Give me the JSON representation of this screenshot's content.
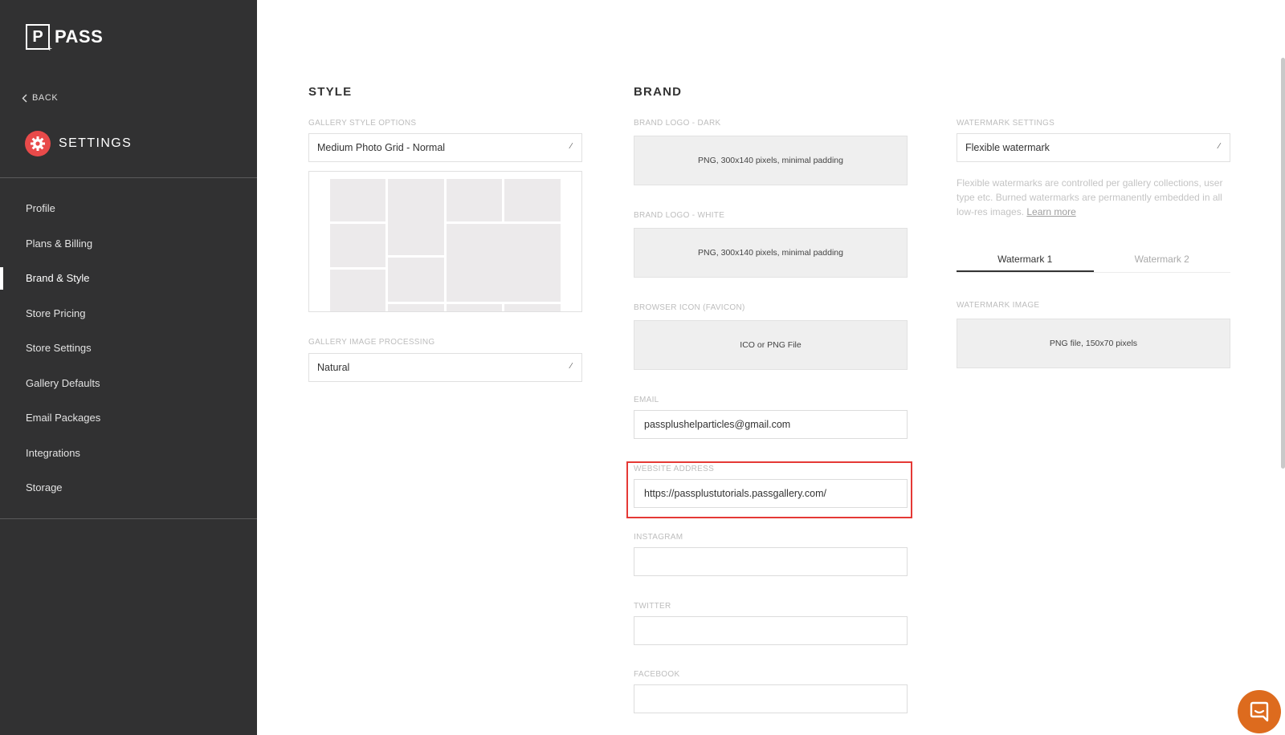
{
  "sidebar": {
    "logo_letter": "P",
    "logo_text": "PASS",
    "back_label": "BACK",
    "title": "SETTINGS",
    "items": [
      {
        "label": "Profile"
      },
      {
        "label": "Plans & Billing"
      },
      {
        "label": "Brand & Style"
      },
      {
        "label": "Store Pricing"
      },
      {
        "label": "Store Settings"
      },
      {
        "label": "Gallery Defaults"
      },
      {
        "label": "Email Packages"
      },
      {
        "label": "Integrations"
      },
      {
        "label": "Storage"
      }
    ],
    "active_item": "Brand & Style"
  },
  "style": {
    "title": "STYLE",
    "gallery_style_label": "GALLERY STYLE OPTIONS",
    "gallery_style_value": "Medium Photo Grid - Normal",
    "image_processing_label": "GALLERY IMAGE PROCESSING",
    "image_processing_value": "Natural"
  },
  "brand": {
    "title": "BRAND",
    "logo_dark_label": "BRAND LOGO - DARK",
    "logo_dark_hint": "PNG, 300x140 pixels, minimal padding",
    "logo_white_label": "BRAND LOGO - WHITE",
    "logo_white_hint": "PNG, 300x140 pixels, minimal padding",
    "favicon_label": "BROWSER ICON (FAVICON)",
    "favicon_hint": "ICO or PNG File",
    "email_label": "EMAIL",
    "email_value": "passplushelparticles@gmail.com",
    "website_label": "WEBSITE ADDRESS",
    "website_value": "https://passplustutorials.passgallery.com/",
    "instagram_label": "INSTAGRAM",
    "instagram_value": "",
    "twitter_label": "TWITTER",
    "twitter_value": "",
    "facebook_label": "FACEBOOK",
    "facebook_value": ""
  },
  "watermark": {
    "settings_label": "WATERMARK SETTINGS",
    "settings_value": "Flexible watermark",
    "help_text": "Flexible watermarks are controlled per gallery collections, user type etc. Burned watermarks are permanently embedded in all low-res images.",
    "learn_more": "Learn more",
    "tabs": [
      {
        "label": "Watermark 1"
      },
      {
        "label": "Watermark 2"
      }
    ],
    "active_tab": "Watermark 1",
    "image_label": "WATERMARK IMAGE",
    "image_hint": "PNG file, 150x70 pixels"
  },
  "colors": {
    "sidebar_bg": "#313132",
    "gear_accent": "#e84a4a",
    "highlight_border": "#e53935",
    "chat_button": "#dd6b1e"
  },
  "icons": {
    "back": "chevron-left-icon",
    "settings": "gear-icon",
    "dropdown": "caret-icon",
    "chat": "chat-bubble-icon"
  }
}
